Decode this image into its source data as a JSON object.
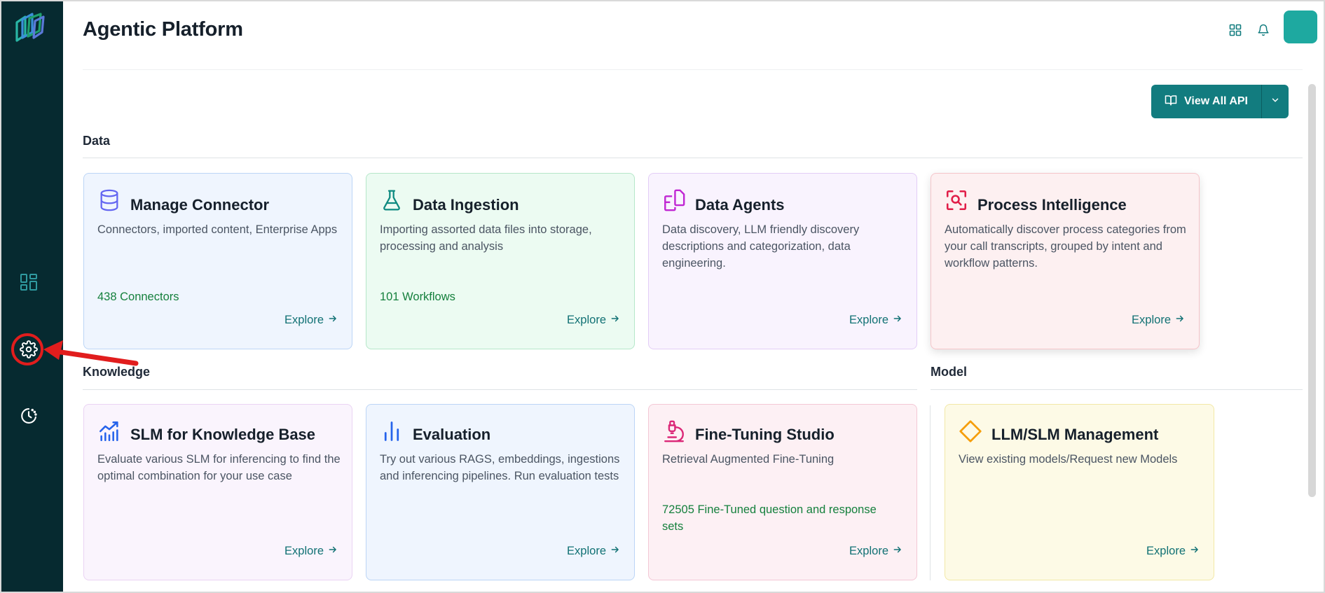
{
  "app": {
    "title": "Agentic Platform"
  },
  "header": {
    "apps_icon": "grid-icon",
    "bell_icon": "bell-icon"
  },
  "sidebar": {
    "items": [
      "dashboard-grid-icon",
      "settings-gear-icon",
      "history-clock-icon"
    ]
  },
  "api_button": {
    "label": "View All API",
    "icon": "book-open-icon"
  },
  "sections": {
    "data": "Data",
    "knowledge": "Knowledge",
    "model": "Model"
  },
  "cards": {
    "manage_connector": {
      "title": "Manage Connector",
      "description": "Connectors, imported content, Enterprise Apps",
      "stat": "438 Connectors",
      "explore": "Explore"
    },
    "data_ingestion": {
      "title": "Data Ingestion",
      "description": "Importing assorted data files into storage, processing and analysis",
      "stat": "101 Workflows",
      "explore": "Explore"
    },
    "data_agents": {
      "title": "Data Agents",
      "description": "Data discovery, LLM friendly discovery descriptions and categorization, data engineering.",
      "explore": "Explore"
    },
    "process_intelligence": {
      "title": "Process Intelligence",
      "description": "Automatically discover process categories from your call transcripts, grouped by intent and workflow patterns.",
      "explore": "Explore"
    },
    "slm_kb": {
      "title": "SLM for Knowledge Base",
      "description": "Evaluate various SLM for inferencing to find the optimal combination for your use case",
      "explore": "Explore"
    },
    "evaluation": {
      "title": "Evaluation",
      "description": "Try out various RAGS, embeddings, ingestions and inferencing pipelines. Run evaluation tests",
      "explore": "Explore"
    },
    "fine_tuning": {
      "title": "Fine-Tuning Studio",
      "description": "Retrieval Augmented Fine-Tuning",
      "stat": "72505 Fine-Tuned question and response sets",
      "explore": "Explore"
    },
    "llm_slm": {
      "title": "LLM/SLM Management",
      "description": "View existing models/Request new Models",
      "explore": "Explore"
    }
  },
  "colors": {
    "sidebar": "#062a30",
    "accent": "#127c7f",
    "stat_green": "#15803d",
    "annotation_red": "#e11d1d"
  }
}
